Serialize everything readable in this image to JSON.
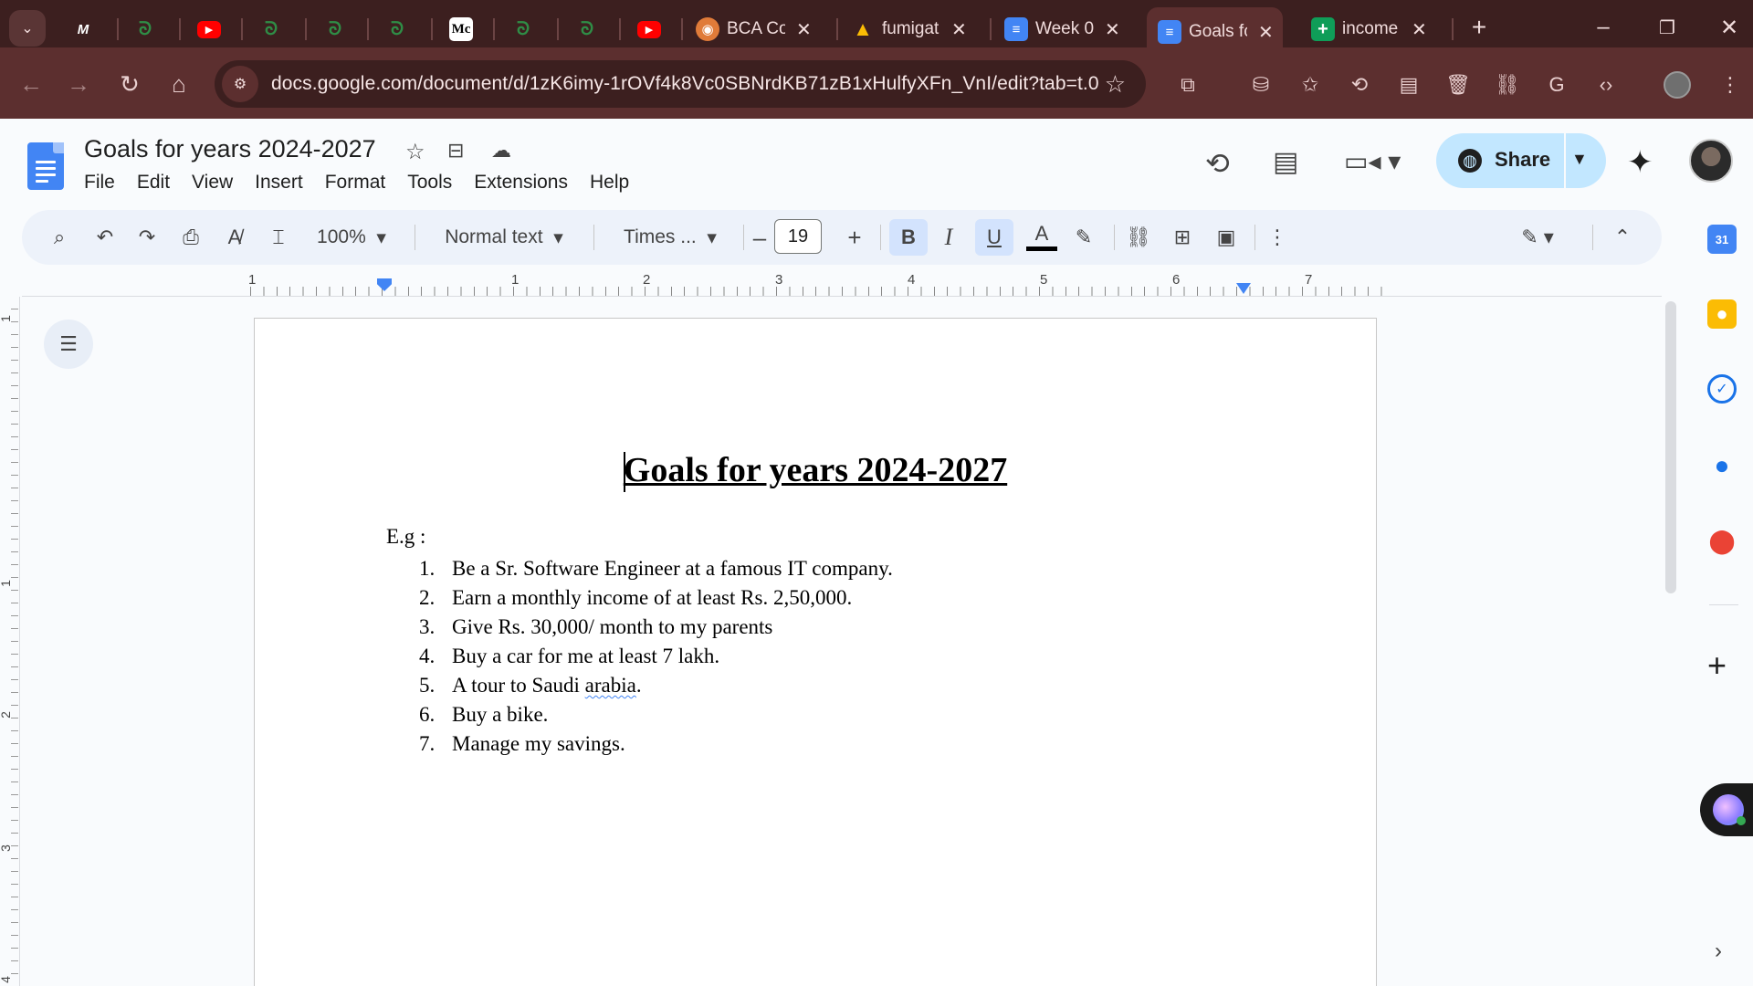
{
  "browser": {
    "tabs": [
      {
        "icon": "medium-icon",
        "title": ""
      },
      {
        "icon": "gfg-icon",
        "title": ""
      },
      {
        "icon": "youtube-icon",
        "title": ""
      },
      {
        "icon": "gfg-icon",
        "title": ""
      },
      {
        "icon": "gfg-icon",
        "title": ""
      },
      {
        "icon": "gfg-icon",
        "title": ""
      },
      {
        "icon": "mc-icon",
        "title": ""
      },
      {
        "icon": "gfg-icon",
        "title": ""
      },
      {
        "icon": "gfg-icon",
        "title": ""
      },
      {
        "icon": "youtube-icon",
        "title": ""
      },
      {
        "icon": "bca-icon",
        "title": "BCA Co"
      },
      {
        "icon": "drive-icon",
        "title": "fumigat"
      },
      {
        "icon": "docs-icon",
        "title": "Week 0"
      },
      {
        "icon": "docs-icon",
        "title": "Goals fc"
      },
      {
        "icon": "sheets-icon",
        "title": "income"
      }
    ],
    "url": "docs.google.com/document/d/1zK6imy-1rOVf4k8Vc0SBNrdKB71zB1xHulfyXFn_VnI/edit?tab=t.0"
  },
  "docs": {
    "title": "Goals for years 2024-2027",
    "menu": [
      "File",
      "Edit",
      "View",
      "Insert",
      "Format",
      "Tools",
      "Extensions",
      "Help"
    ],
    "share_label": "Share"
  },
  "toolbar": {
    "zoom": "100%",
    "style": "Normal text",
    "font": "Times ...",
    "font_size": "19",
    "bold": "B",
    "italic": "I",
    "underline": "U",
    "text_color": "A"
  },
  "ruler": {
    "h_numbers": [
      "1",
      "1",
      "2",
      "3",
      "4",
      "5",
      "6",
      "7"
    ],
    "v_numbers": [
      "1",
      "1",
      "2",
      "3",
      "4"
    ]
  },
  "document": {
    "heading": "Goals for years 2024-2027",
    "intro": "E.g :",
    "items": [
      {
        "num": "1.",
        "text": "Be a Sr. Software Engineer at a famous IT company."
      },
      {
        "num": "2.",
        "text": "Earn a monthly income of at least Rs. 2,50,000."
      },
      {
        "num": "3.",
        "text": "Give Rs. 30,000/ month to my parents"
      },
      {
        "num": "4.",
        "text": "Buy a car for me at least 7 lakh."
      },
      {
        "num": "5.",
        "text_before": "A tour to Saudi ",
        "text_misspelled": "arabia",
        "text_after": "."
      },
      {
        "num": "6.",
        "text": "Buy a bike."
      },
      {
        "num": "7.",
        "text": "Manage my savings."
      }
    ]
  },
  "side_panel": {
    "calendar_day": "31"
  },
  "colors": {
    "chrome_dark": "#3c1f1f",
    "chrome_mid": "#5c2f2f",
    "docs_blue": "#4285f4",
    "share_bg": "#c2e7ff",
    "toolbar_bg": "#edf2fa"
  }
}
